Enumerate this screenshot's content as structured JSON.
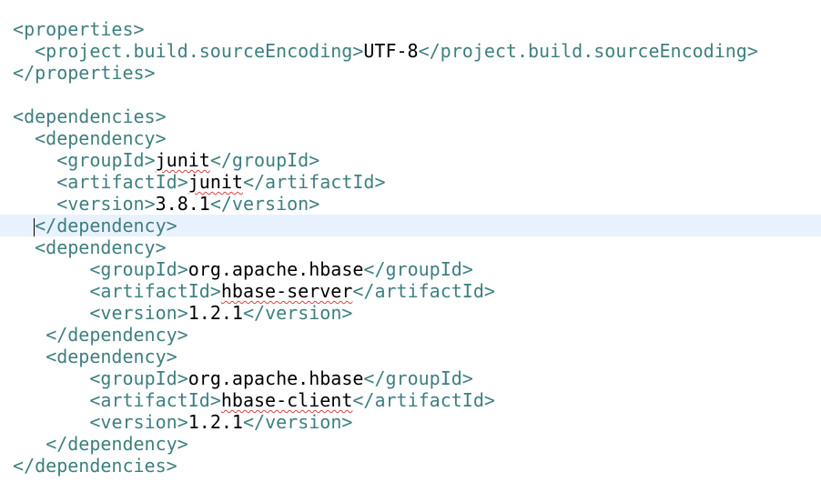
{
  "editor": {
    "current_line": 9,
    "lines": [
      {
        "indent": 1,
        "open": "<properties>",
        "text": "",
        "close": ""
      },
      {
        "indent": 3,
        "open": "<project.build.sourceEncoding>",
        "text": "UTF-8",
        "close": "</project.build.sourceEncoding>"
      },
      {
        "indent": 1,
        "open": "</properties>",
        "text": "",
        "close": ""
      },
      {
        "indent": 0,
        "open": "",
        "text": "",
        "close": ""
      },
      {
        "indent": 1,
        "open": "<dependencies>",
        "text": "",
        "close": ""
      },
      {
        "indent": 3,
        "open": "<dependency>",
        "text": "",
        "close": ""
      },
      {
        "indent": 5,
        "open": "<groupId>",
        "text": "junit",
        "close": "</groupId>",
        "spell": true
      },
      {
        "indent": 5,
        "open": "<artifactId>",
        "text": "junit",
        "close": "</artifactId>",
        "spell": true
      },
      {
        "indent": 5,
        "open": "<version>",
        "text": "3.8.1",
        "close": "</version>"
      },
      {
        "indent": 3,
        "open": "</dependency>",
        "text": "",
        "close": "",
        "caret": true
      },
      {
        "indent": 3,
        "open": "<dependency>",
        "text": "",
        "close": ""
      },
      {
        "indent": 8,
        "open": "<groupId>",
        "text": "org.apache.hbase",
        "close": "</groupId>"
      },
      {
        "indent": 8,
        "open": "<artifactId>",
        "text": "hbase-server",
        "close": "</artifactId>",
        "spell": true
      },
      {
        "indent": 8,
        "open": "<version>",
        "text": "1.2.1",
        "close": "</version>"
      },
      {
        "indent": 4,
        "open": "</dependency>",
        "text": "",
        "close": ""
      },
      {
        "indent": 4,
        "open": "<dependency>",
        "text": "",
        "close": ""
      },
      {
        "indent": 8,
        "open": "<groupId>",
        "text": "org.apache.hbase",
        "close": "</groupId>"
      },
      {
        "indent": 8,
        "open": "<artifactId>",
        "text": "hbase-client",
        "close": "</artifactId>",
        "spell": true
      },
      {
        "indent": 8,
        "open": "<version>",
        "text": "1.2.1",
        "close": "</version>"
      },
      {
        "indent": 4,
        "open": "</dependency>",
        "text": "",
        "close": ""
      },
      {
        "indent": 1,
        "open": "</dependencies>",
        "text": "",
        "close": ""
      }
    ]
  }
}
